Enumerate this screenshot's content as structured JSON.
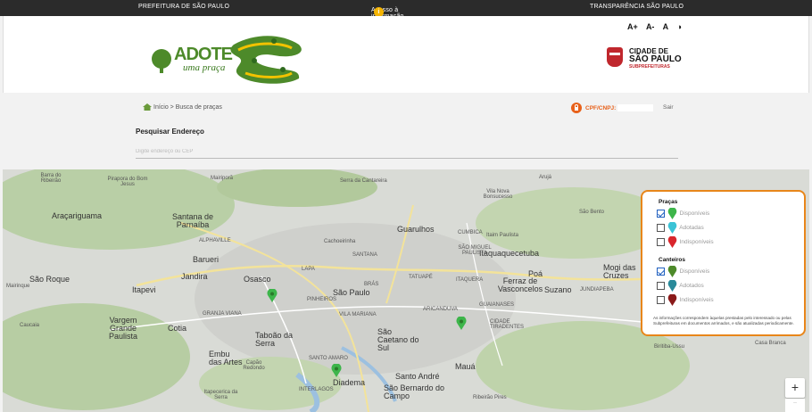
{
  "topbar": {
    "left": "PREFEITURA DE SÃO PAULO",
    "center": "Acesso à informação",
    "info_glyph": "i",
    "right": "TRANSPARÊNCIA SÃO PAULO"
  },
  "header": {
    "font_controls": [
      "A+",
      "A-",
      "A",
      "◑"
    ],
    "logo_adote_line1": "ADOTE",
    "logo_adote_line2": "uma praça",
    "city_logo_line1": "CIDADE DE",
    "city_logo_line2": "SÃO PAULO",
    "city_logo_line3": "SUBPREFEITURAS"
  },
  "breadcrumb": "Início > Busca de praças",
  "cpf": {
    "label": "CPF/CNPJ:",
    "logout": "Sair"
  },
  "search": {
    "title": "Pesquisar Endereço",
    "placeholder": "Digite endereço ou CEP"
  },
  "map": {
    "places": [
      {
        "name": "Serra da Cantareira",
        "size": "small"
      },
      {
        "name": "Guarulhos",
        "size": "big"
      },
      {
        "name": "São Paulo",
        "size": "big"
      },
      {
        "name": "Osasco",
        "size": "big"
      },
      {
        "name": "Barueri",
        "size": "big"
      },
      {
        "name": "Jandira",
        "size": "big"
      },
      {
        "name": "Itapevi",
        "size": "big"
      },
      {
        "name": "Cotia",
        "size": "big"
      },
      {
        "name": "Diadema",
        "size": "big"
      },
      {
        "name": "Mauá",
        "size": "big"
      },
      {
        "name": "Santo André",
        "size": "big"
      },
      {
        "name": "São Bernardo do Campo",
        "size": "big"
      },
      {
        "name": "São Caetano do Sul",
        "size": "big"
      },
      {
        "name": "Taboão da Serra",
        "size": "big"
      },
      {
        "name": "Embu das Artes",
        "size": "big"
      },
      {
        "name": "Suzano",
        "size": "big"
      },
      {
        "name": "Poá",
        "size": "big"
      },
      {
        "name": "Ferraz de Vasconcelos",
        "size": "big"
      },
      {
        "name": "Itaquaquecetuba",
        "size": "big"
      },
      {
        "name": "Mogi das Cruzes",
        "size": "big"
      },
      {
        "name": "Santana de Parnaíba",
        "size": "big"
      },
      {
        "name": "Vargem Grande Paulista",
        "size": "big"
      },
      {
        "name": "São Roque",
        "size": "big"
      },
      {
        "name": "Araçariguama",
        "size": "big"
      },
      {
        "name": "Pirapora do Bom Jesus",
        "size": "small"
      },
      {
        "name": "Mairiporã",
        "size": "small"
      },
      {
        "name": "Arujá",
        "size": "small"
      },
      {
        "name": "Cachoeirinha",
        "size": "small"
      },
      {
        "name": "SANTANA",
        "size": "small"
      },
      {
        "name": "LAPA",
        "size": "small"
      },
      {
        "name": "TATUAPÉ",
        "size": "small"
      },
      {
        "name": "ITAQUERA",
        "size": "small"
      },
      {
        "name": "VILA MARIANA",
        "size": "small"
      },
      {
        "name": "PINHEIROS",
        "size": "small"
      },
      {
        "name": "SANTO AMARO",
        "size": "small"
      },
      {
        "name": "INTERLAGOS",
        "size": "small"
      },
      {
        "name": "GUAIANASES",
        "size": "small"
      },
      {
        "name": "CIDADE TIRADENTES",
        "size": "small"
      },
      {
        "name": "ARICANDUVA",
        "size": "small"
      },
      {
        "name": "JUNDIAPEBA",
        "size": "small"
      },
      {
        "name": "ALPHAVILLE",
        "size": "small"
      },
      {
        "name": "GRANJA VIANA",
        "size": "small"
      },
      {
        "name": "Itapecerica da Serra",
        "size": "small"
      },
      {
        "name": "Ribeirão Pires",
        "size": "small"
      },
      {
        "name": "Biritiba-Ussu",
        "size": "small"
      },
      {
        "name": "Caucaia",
        "size": "small"
      },
      {
        "name": "Mairinque",
        "size": "small"
      },
      {
        "name": "São Bento",
        "size": "small"
      },
      {
        "name": "Casa Branca",
        "size": "small"
      },
      {
        "name": "CUMBICA",
        "size": "small"
      },
      {
        "name": "BRÁS",
        "size": "small"
      },
      {
        "name": "Itaim Paulista",
        "size": "small"
      },
      {
        "name": "SÃO MIGUEL PAULISTA",
        "size": "small"
      },
      {
        "name": "Capão Redondo",
        "size": "small"
      },
      {
        "name": "Barra do Ribeirão",
        "size": "small"
      },
      {
        "name": "Vila Nova Bonsucesso",
        "size": "small"
      }
    ]
  },
  "legend": {
    "pracas_title": "Praças",
    "canteiros_title": "Canteiros",
    "pracas": [
      {
        "label": "Disponíveis",
        "checked": true,
        "color": "#3db54a"
      },
      {
        "label": "Adotadas",
        "checked": false,
        "color": "#3bc3d6"
      },
      {
        "label": "Indisponíveis",
        "checked": false,
        "color": "#d9262c"
      }
    ],
    "canteiros": [
      {
        "label": "Disponíveis",
        "checked": true,
        "color": "#4d8a2a"
      },
      {
        "label": "Adotados",
        "checked": false,
        "color": "#2a8a9a"
      },
      {
        "label": "Indisponíveis",
        "checked": false,
        "color": "#8a1a1a"
      }
    ],
    "note": "As informações correspondem àquelas prestadas pelo interessado ou pelas Subprefeituras em documentos arrimados, e são atualizadas periodicamente."
  },
  "zoom": {
    "in": "+",
    "out": "−"
  },
  "colors": {
    "accent": "#e8861a",
    "topbar": "#2b2b2b",
    "green": "#3db54a"
  }
}
